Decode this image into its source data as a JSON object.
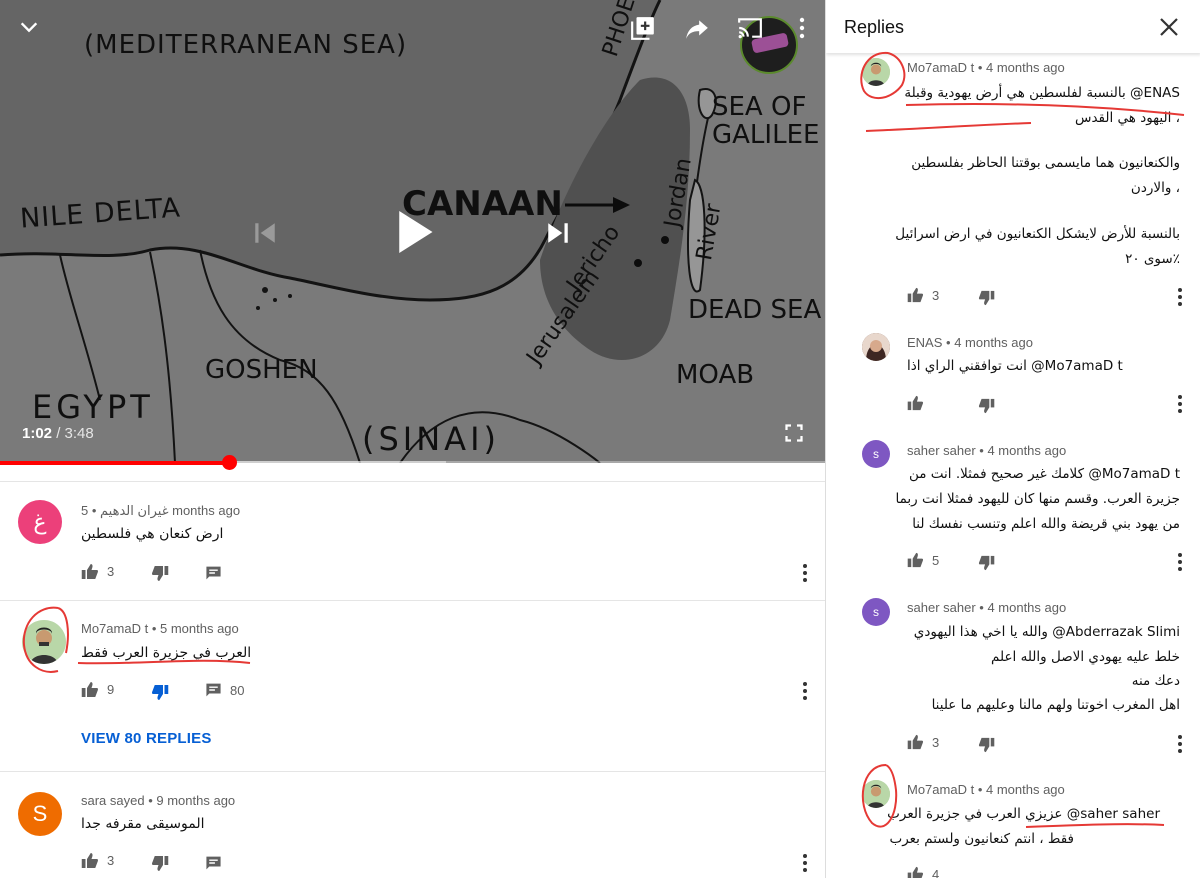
{
  "video": {
    "map_labels": {
      "sea": "(MEDITERRANEAN SEA)",
      "nile_delta": "NILE DELTA",
      "canaan": "CANAAN",
      "goshen": "GOSHEN",
      "egypt": "EGYPT",
      "sinai": "(SINAI)",
      "moab": "MOAB",
      "dead_sea": "DEAD SEA",
      "sea_of": "SEA OF",
      "galilee": "GALILEE",
      "phoenicia": "PHOE",
      "jericho": "Jericho",
      "jerusalem": "Jerusalem",
      "jordan": "Jordan",
      "river": "River"
    },
    "current_time": "1:02",
    "duration": "3:48",
    "time_separator": "/",
    "progress_fraction": 0.277,
    "buffered_fraction": 0.54,
    "colors": {
      "progress": "#ff0000"
    },
    "icons": [
      "chevron-down-icon",
      "add-to-playlist-icon",
      "share-icon",
      "cast-icon",
      "more-vert-icon",
      "previous-icon",
      "play-icon",
      "next-icon",
      "fullscreen-icon"
    ]
  },
  "comments": [
    {
      "author": "غيران الدهيم",
      "time": "5 months ago",
      "text": "ارض كنعان هي فلسطين",
      "likes": "3",
      "avatar_letter": "غ",
      "avatar_color": "#ec407a"
    },
    {
      "author": "Mo7amaD t",
      "time": "5 months ago",
      "text": "العرب في جزيرة العرب فقط",
      "likes": "9",
      "replies": "80",
      "view_replies": "VIEW 80 REPLIES"
    },
    {
      "author": "sara sayed",
      "time": "9 months ago",
      "text": "الموسيقى مقرفه جدا",
      "likes": "3",
      "avatar_letter": "S",
      "avatar_color": "#ef6c00"
    }
  ],
  "replies_panel": {
    "title": "Replies",
    "replies": [
      {
        "author": "Mo7amaD t",
        "time": "4 months ago",
        "lines": [
          "بالنسبة لفلسطين هي أرض يهودية وقبلة @ENAS",
          "اليهود هي القدس ،",
          "والكنعانيون هما مايسمى بوقتنا الحاظر بفلسطين",
          "والاردن ،",
          "بالنسبة للأرض لايشكل الكنعانيون في ارض اسرائيل",
          "سوى ٢٠٪"
        ],
        "likes": "3"
      },
      {
        "author": "ENAS",
        "time": "4 months ago",
        "lines": [
          "انت توافقني الراي اذا @Mo7amaD t"
        ],
        "likes": ""
      },
      {
        "author": "saher saher",
        "time": "4 months ago",
        "avatar_letter": "s",
        "avatar_color": "#7e57c2",
        "lines": [
          "كلامك غير صحيح فمثلا. انت من @Mo7amaD t",
          "جزيرة العرب. وقسم منها كان لليهود فمثلا انت ربما",
          "من يهود بني قريضة والله اعلم وتنسب نفسك لنا"
        ],
        "likes": "5"
      },
      {
        "author": "saher saher",
        "time": "4 months ago",
        "avatar_letter": "s",
        "avatar_color": "#7e57c2",
        "lines": [
          "والله يا اخي هذا اليهودي @Abderrazak Slimi",
          "خلط عليه يهودي الاصل والله اعلم",
          "دعك منه",
          "اهل المغرب  اخوتنا ولهم مالنا وعليهم ما علينا"
        ],
        "likes": "3"
      },
      {
        "author": "Mo7amaD t",
        "time": "4 months ago",
        "lines": [
          "عزيزي العرب في جزيرة العرب @saher saher",
          "فقط ، انتم كنعانيون ولستم بعرب"
        ],
        "likes": "4"
      }
    ]
  }
}
